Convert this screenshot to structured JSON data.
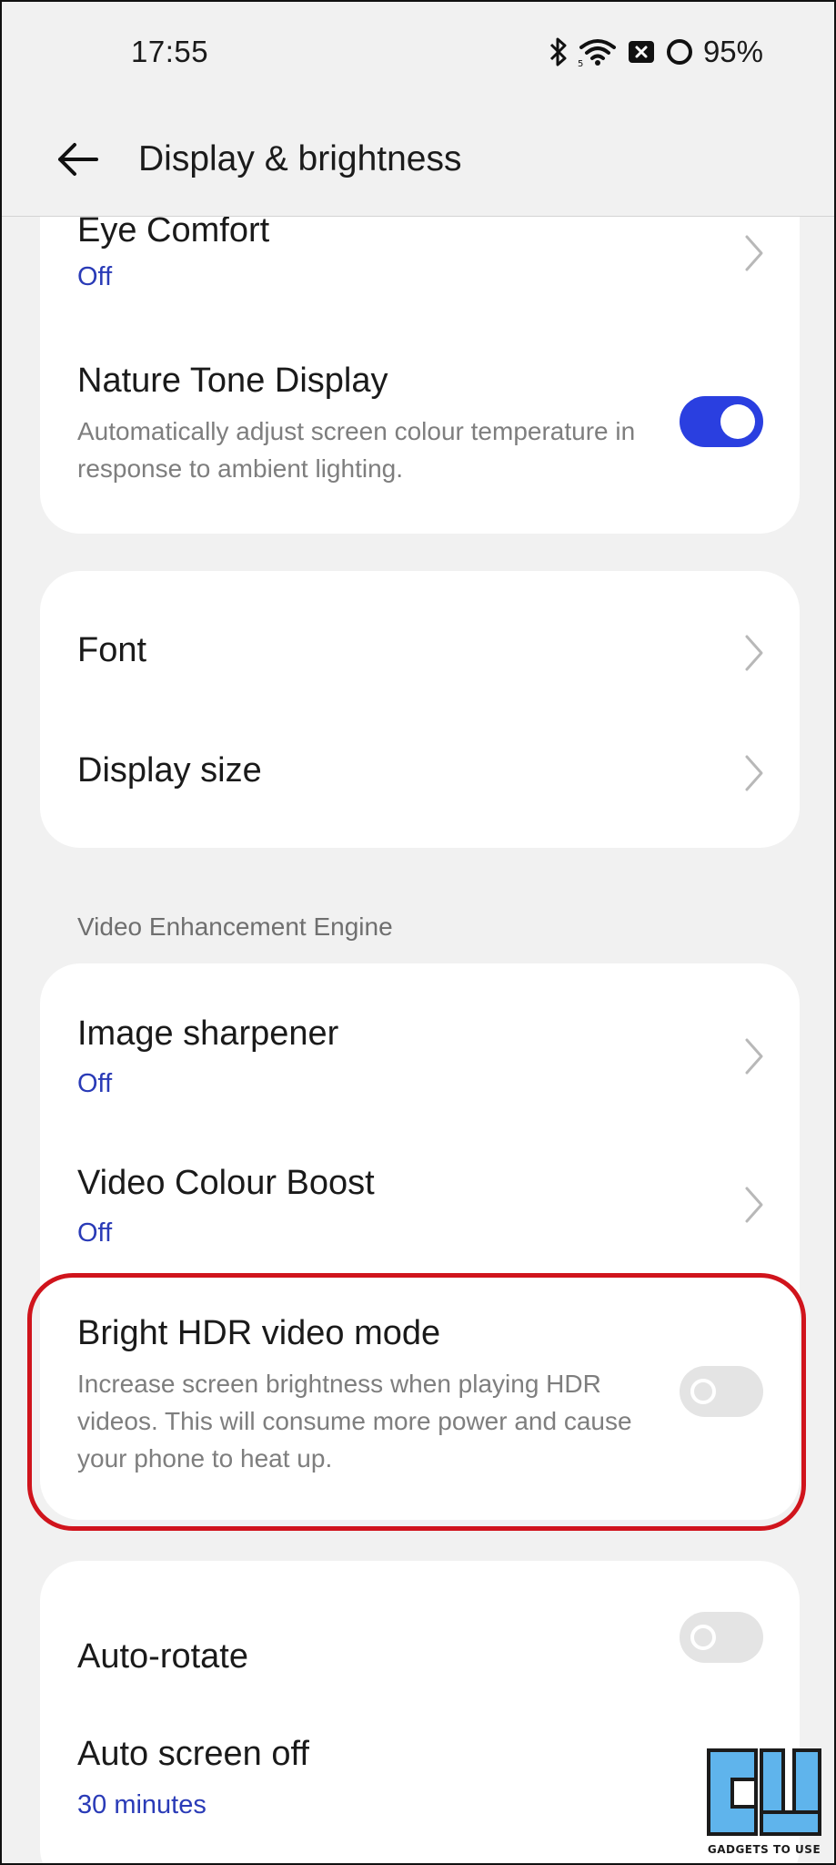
{
  "status_bar": {
    "time": "17:55",
    "battery": "95%"
  },
  "header": {
    "title": "Display & brightness"
  },
  "card1": {
    "eye_comfort": {
      "title": "Eye Comfort",
      "value": "Off"
    },
    "nature_tone": {
      "title": "Nature Tone Display",
      "description": "Automatically adjust screen colour temperature in response to ambient lighting.",
      "enabled": true
    }
  },
  "card2": {
    "font": {
      "title": "Font"
    },
    "display_size": {
      "title": "Display size"
    }
  },
  "video_section": {
    "header": "Video Enhancement Engine",
    "image_sharpener": {
      "title": "Image sharpener",
      "value": "Off"
    },
    "video_colour_boost": {
      "title": "Video Colour Boost",
      "value": "Off"
    },
    "bright_hdr": {
      "title": "Bright HDR video mode",
      "description": "Increase screen brightness when playing HDR videos. This will consume more power and cause your phone to heat up.",
      "enabled": false
    }
  },
  "card4": {
    "auto_rotate": {
      "title": "Auto-rotate",
      "enabled": false
    },
    "auto_screen_off": {
      "title": "Auto screen off",
      "value": "30 minutes"
    }
  },
  "watermark": {
    "caption": "GADGETS TO USE"
  },
  "colors": {
    "accent": "#2a3fe0",
    "value_text": "#2a3bb7",
    "highlight": "#d0141c",
    "background": "#f1f1f1",
    "card": "#ffffff"
  }
}
